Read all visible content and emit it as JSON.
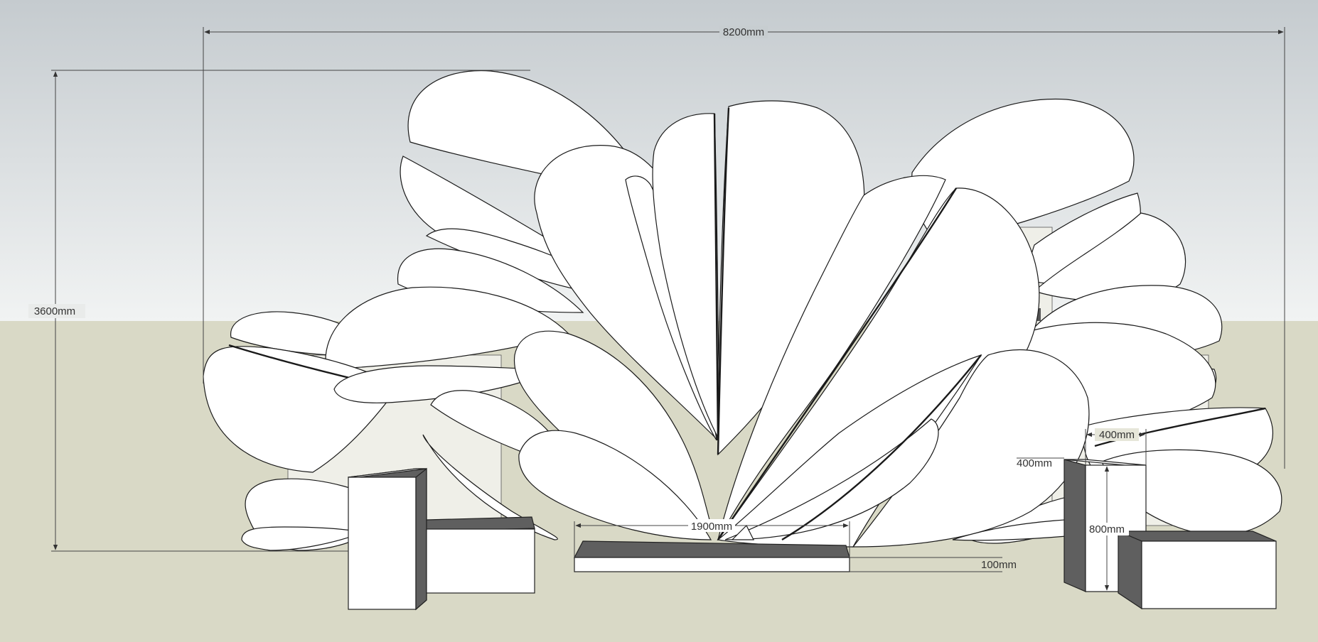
{
  "drawing": {
    "dimensions": {
      "overall_width": "8200mm",
      "overall_height": "3600mm",
      "base_width": "1900mm",
      "base_height": "100mm",
      "stool_width": "400mm",
      "stool_depth": "400mm",
      "stool_height": "800mm"
    },
    "colors": {
      "sky_top": "#c5cbcf",
      "sky_bottom": "#f1f3f3",
      "ground": "#d9d9c6",
      "petal_fill": "#ffffff",
      "shadow_face": "#5f5f5f",
      "dimension_line": "#444444"
    }
  }
}
